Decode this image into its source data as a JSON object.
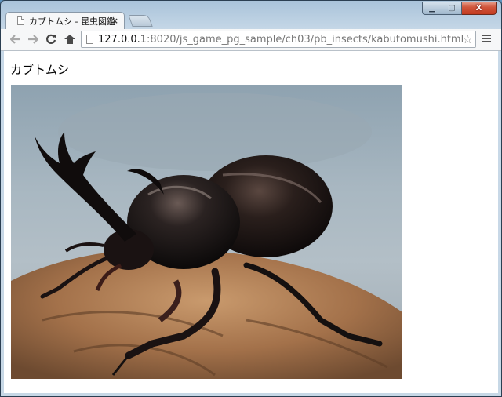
{
  "browser": {
    "tab_title": "カブトムシ - 昆虫図鑑",
    "tab_close": "×",
    "url_host": "127.0.0.1",
    "url_rest": ":8020/js_game_pg_sample/ch03/pb_insects/kabutomushi.html",
    "icons": {
      "back": "back-arrow-icon",
      "forward": "forward-arrow-icon",
      "reload": "reload-icon",
      "home": "home-icon",
      "page": "page-icon",
      "bookmark": "star-icon",
      "menu": "menu-icon"
    }
  },
  "page": {
    "heading": "カブトムシ",
    "image_subject": "rhinoceros beetle on tree bark"
  },
  "window": {
    "min_glyph": "▁",
    "max_glyph": "▢",
    "close_glyph": "X"
  }
}
